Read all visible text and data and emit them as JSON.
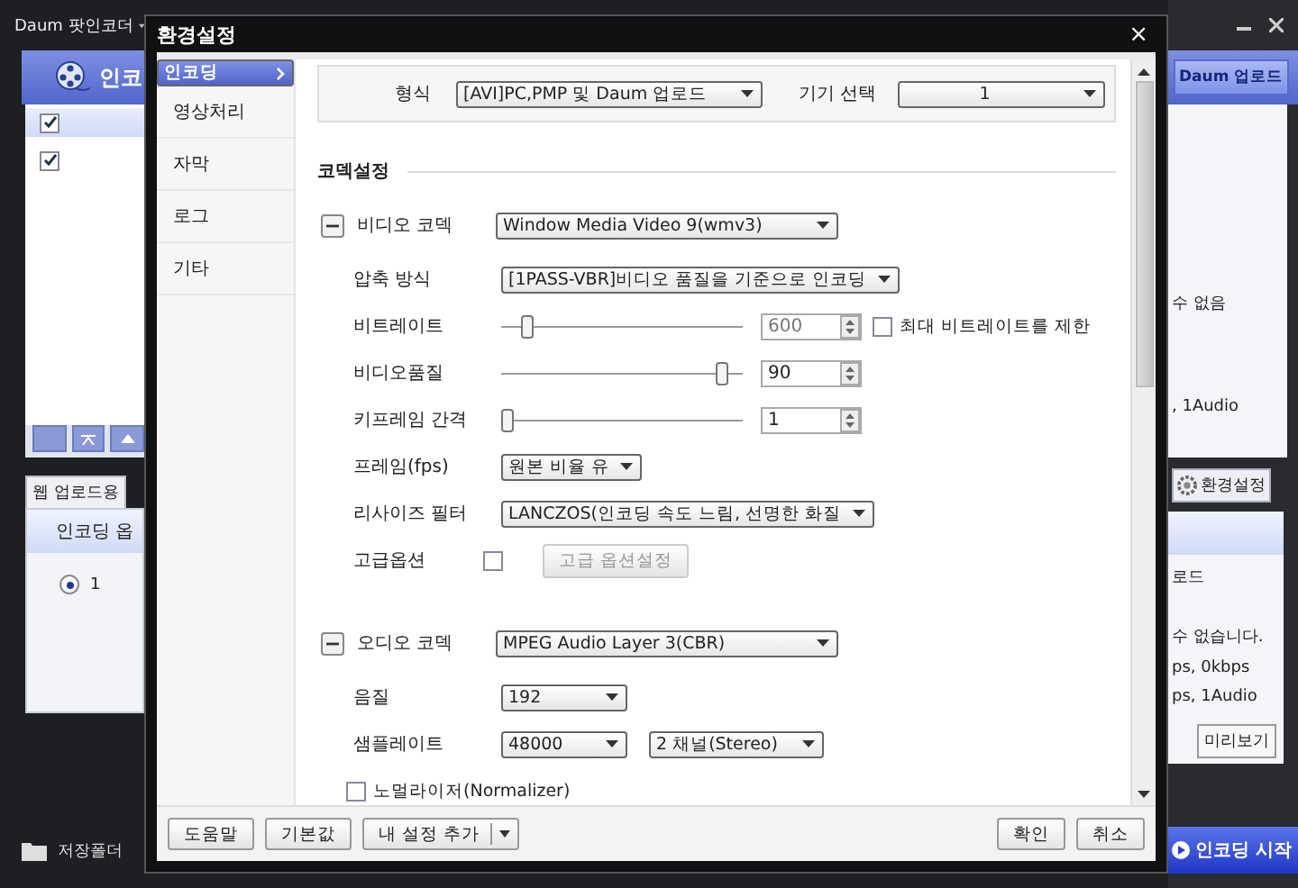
{
  "app": {
    "title": "Daum 팟인코더",
    "header_label": "인코",
    "list_checks": [
      {
        "checked": true
      },
      {
        "checked": true
      }
    ],
    "tab": "웹 업로드용",
    "options_header": "인코딩 옵",
    "options": [
      {
        "label": "1",
        "selected": true
      }
    ],
    "folder_button": "저장폴더",
    "upload_button": "Daum 업로드",
    "list_texts": [
      "수 없음",
      ", 1Audio"
    ],
    "settings_button": "환경설정",
    "detail_texts": [
      "로드",
      "수 없습니다.",
      "ps, 0kbps",
      "ps, 1Audio"
    ],
    "preview_button": "미리보기",
    "start_button": "인코딩 시작"
  },
  "dialog": {
    "title": "환경설정",
    "close": "×",
    "nav": [
      {
        "label": "인코딩",
        "selected": true
      },
      {
        "label": "영상처리",
        "selected": false
      },
      {
        "label": "자막",
        "selected": false
      },
      {
        "label": "로그",
        "selected": false
      },
      {
        "label": "기타",
        "selected": false
      }
    ],
    "format": {
      "label": "형식",
      "value": "[AVI]PC,PMP 및 Daum 업로드"
    },
    "device": {
      "label": "기기 선택",
      "value": "1"
    },
    "section": "코덱설정",
    "codecs": [
      {
        "label": "비디오 코덱",
        "value": "Window Media Video 9(wmv3)",
        "expanded": true,
        "rows": [
          {
            "kind": "select",
            "label": "압축 방식",
            "value": "[1PASS-VBR]비디오 품질을 기준으로 인코딩"
          },
          {
            "kind": "slider",
            "label": "비트레이트",
            "level": 0.08,
            "value": "600",
            "disabled": true,
            "limit": {
              "label": "최대 비트레이트를 제한",
              "checked": false
            }
          },
          {
            "kind": "slider",
            "label": "비디오품질",
            "level": 0.9,
            "value": "90",
            "disabled": false
          },
          {
            "kind": "slider",
            "label": "키프레임 간격",
            "level": 0,
            "value": "1",
            "disabled": false
          },
          {
            "kind": "select",
            "label": "프레임(fps)",
            "value": "원본 비율 유"
          },
          {
            "kind": "select",
            "label": "리사이즈 필터",
            "value": "LANCZOS(인코딩 속도 느림, 선명한 화질"
          },
          {
            "kind": "option",
            "label": "고급옵션",
            "checked": false,
            "button": {
              "label": "고급 옵션설정",
              "disabled": true
            }
          }
        ]
      },
      {
        "label": "오디오 코덱",
        "value": "MPEG Audio Layer 3(CBR)",
        "expanded": true,
        "rows": [
          {
            "kind": "select",
            "label": "음질",
            "value": "192"
          },
          {
            "kind": "select",
            "label": "샘플레이트",
            "value": "48000",
            "extra": "2 채널(Stereo)"
          },
          {
            "kind": "check",
            "label": "노멀라이저(Normalizer)",
            "checked": false
          }
        ]
      }
    ],
    "footer_left": [
      "도움말",
      "기본값"
    ],
    "footer_split": "내 설정 추가",
    "footer_right": [
      "확인",
      "취소"
    ]
  }
}
